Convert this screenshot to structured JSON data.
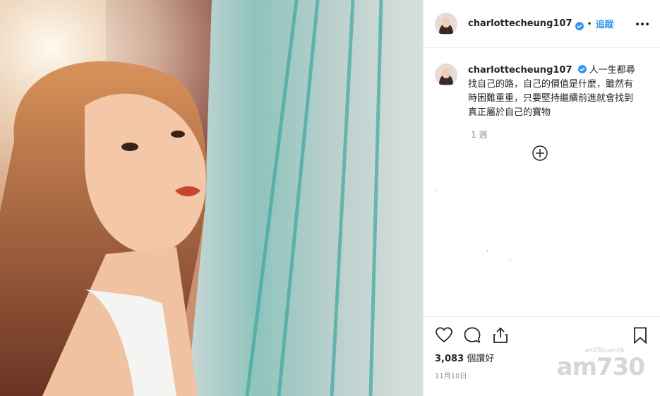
{
  "post": {
    "username": "charlottecheung107",
    "follow_label": "追蹤",
    "dot": "•",
    "caption": "人一生都尋找自己的路，自己的價值是什麼，雖然有時困難重重，只要堅持繼續前進就會找到真正屬於自己的寶物",
    "comment_time": "1 週",
    "likes_count": "3,083",
    "likes_suffix": " 個讚好",
    "date": "11月10日"
  },
  "watermark": {
    "brand": "am730",
    "sub": "am730.com.hk"
  },
  "colors": {
    "accent": "#3897f0",
    "text": "#262626",
    "muted": "#8e8e8e"
  },
  "icons": [
    "verified-badge-icon",
    "more-options-icon",
    "add-icon",
    "heart-icon",
    "comment-icon",
    "share-icon",
    "bookmark-icon"
  ]
}
